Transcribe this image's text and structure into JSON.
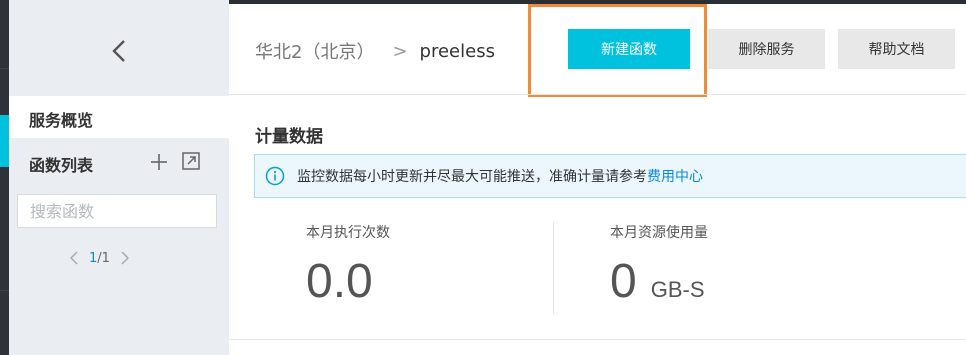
{
  "sidebar": {
    "overview_label": "服务概览",
    "functions_label": "函数列表",
    "search_placeholder": "搜索函数",
    "pager": {
      "current": "1",
      "total": "/1"
    }
  },
  "header": {
    "breadcrumb_region": "华北2（北京）",
    "breadcrumb_sep": ">",
    "breadcrumb_service": "preeless",
    "new_function_label": "新建函数",
    "delete_service_label": "删除服务",
    "help_docs_label": "帮助文档"
  },
  "metrics_section": {
    "title": "计量数据",
    "notice_text": "监控数据每小时更新并尽最大可能推送，准确计量请参考",
    "notice_link": "费用中心",
    "items": [
      {
        "label": "本月执行次数",
        "value": "0.0",
        "unit": ""
      },
      {
        "label": "本月资源使用量",
        "value": "0",
        "unit": "GB-S"
      }
    ]
  },
  "colors": {
    "accent": "#00c1de",
    "highlight": "#f08a3c",
    "link": "#0a8ad6",
    "sidebar_bg": "#eaedf1"
  }
}
